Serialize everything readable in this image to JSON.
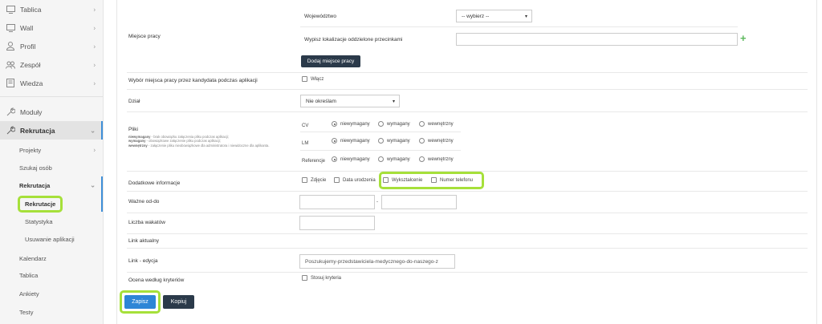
{
  "sidebar": {
    "items": [
      {
        "label": "Tablica",
        "icon": "monitor-icon"
      },
      {
        "label": "Wall",
        "icon": "monitor-icon"
      },
      {
        "label": "Profil",
        "icon": "user-icon"
      },
      {
        "label": "Zespół",
        "icon": "users-icon"
      },
      {
        "label": "Wiedza",
        "icon": "book-icon"
      },
      {
        "label": "Moduły",
        "icon": "wrench-icon"
      },
      {
        "label": "Rekrutacja",
        "icon": "wrench-icon"
      }
    ],
    "sub": {
      "projekty": "Projekty",
      "szukaj": "Szukaj osób",
      "rekrutacja": "Rekrutacja",
      "rekrutacje": "Rekrutacje",
      "statystyka": "Statystyka",
      "usuwanie": "Usuwanie aplikacji",
      "kalendarz": "Kalendarz",
      "tablica": "Tablica",
      "ankiety": "Ankiety",
      "testy": "Testy"
    }
  },
  "form": {
    "miejsce_pracy": {
      "label": "Miejsce pracy",
      "wojewodztwo_label": "Województwo",
      "wojewodztwo_value": "-- wybierz --",
      "lokalizacje_label": "Wypisz lokalizacje oddzielone przecinkami",
      "lokalizacje_value": "",
      "add_button": "Dodaj miejsce pracy"
    },
    "wybor": {
      "label": "Wybór miejsca pracy przez kandydata podczas aplikacji",
      "option": "Włącz"
    },
    "dzial": {
      "label": "Dział",
      "value": "Nie określam"
    },
    "pliki": {
      "label": "Pliki",
      "hint_1_b": "niewymagany",
      "hint_1": " - brak obowiązku załączenia pliku podczas aplikacji;",
      "hint_2_b": "wymagany",
      "hint_2": " - obowiązkowe załączenie pliku podczas aplikacji;",
      "hint_3_b": "wewnętrzny",
      "hint_3": " - załączenie pliku nieobowiązkowe dla administratora i niewidoczne dla aplikanta.",
      "rows": [
        {
          "name": "CV",
          "selected": "niewymagany"
        },
        {
          "name": "LM",
          "selected": "niewymagany"
        },
        {
          "name": "Referencje",
          "selected": "niewymagany"
        }
      ],
      "options": [
        "niewymagany",
        "wymagany",
        "wewnętrzny"
      ]
    },
    "dodatkowe": {
      "label": "Dodatkowe informacje",
      "options": [
        "Zdjęcie",
        "Data urodzenia",
        "Wykształcenie",
        "Numer telefonu"
      ]
    },
    "wazne": {
      "label": "Ważne od-do",
      "from": "",
      "separator": "-",
      "to": ""
    },
    "wakatow": {
      "label": "Liczba wakatów",
      "value": ""
    },
    "link_aktualny": {
      "label": "Link aktualny"
    },
    "link_edycja": {
      "label": "Link - edycja",
      "value": "Poszukujemy-przedstawiciela-medycznego-do-naszego-z"
    },
    "ocena": {
      "label": "Ocena według kryteriów",
      "option": "Stosuj kryteria"
    },
    "save_button": "Zapisz",
    "copy_button": "Kopiuj"
  },
  "colors": {
    "highlight": "#a6e03a",
    "primary": "#2e86d6",
    "dark": "#2b3a4a",
    "plus": "#5cb85c"
  }
}
